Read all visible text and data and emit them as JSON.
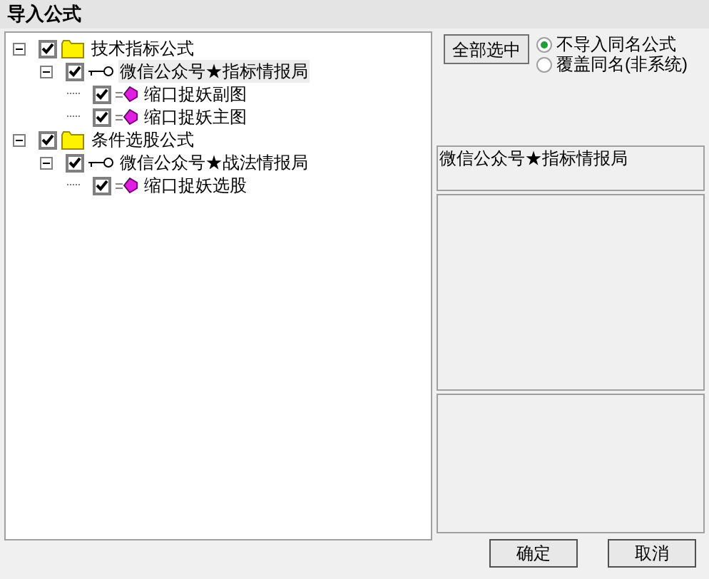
{
  "window": {
    "title": "导入公式"
  },
  "tree": [
    {
      "kind": "folder",
      "label": "技术指标公式",
      "checked": true,
      "expanded": true,
      "selected": false,
      "children": [
        {
          "kind": "group",
          "label": "微信公众号★指标情报局",
          "checked": true,
          "expanded": true,
          "selected": true,
          "children": [
            {
              "kind": "formula",
              "label": "缩口捉妖副图",
              "checked": true,
              "selected": false
            },
            {
              "kind": "formula",
              "label": "缩口捉妖主图",
              "checked": true,
              "selected": false
            }
          ]
        }
      ]
    },
    {
      "kind": "folder",
      "label": "条件选股公式",
      "checked": true,
      "expanded": true,
      "selected": false,
      "children": [
        {
          "kind": "group",
          "label": "微信公众号★战法情报局",
          "checked": true,
          "expanded": true,
          "selected": false,
          "children": [
            {
              "kind": "formula",
              "label": "缩口捉妖选股",
              "checked": true,
              "selected": false
            }
          ]
        }
      ]
    }
  ],
  "select_all_button": "全部选中",
  "options": [
    {
      "label": "不导入同名公式",
      "selected": true
    },
    {
      "label": "覆盖同名(非系统)",
      "selected": false
    }
  ],
  "formula_name": "微信公众号★指标情报局",
  "buttons": [
    "确定",
    "取消"
  ]
}
